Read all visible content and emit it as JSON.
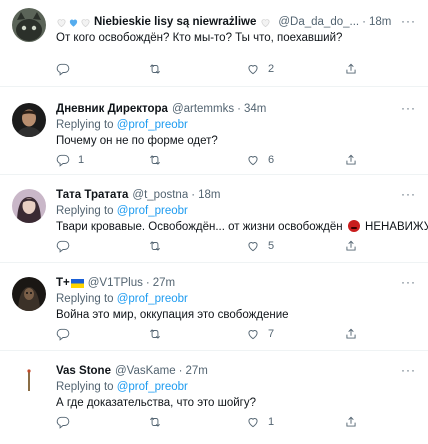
{
  "tweets": [
    {
      "name": "Niebieskie lisy są niewrażliwe",
      "handle": "@Da_da_do_...",
      "time": "18m",
      "replying_prefix": "",
      "replying_link": "",
      "text": "От кого освобождён? Кто мы-то? Ты что, поехавший?",
      "reply_count": "",
      "retweet_count": "",
      "like_count": "2",
      "avatar_icon": "dark-cat-avatar"
    },
    {
      "name": "Дневник Директора",
      "handle": "@artemmks",
      "time": "34m",
      "replying_prefix": "Replying to ",
      "replying_link": "@prof_preobr",
      "text": "Почему он не по форме одет?",
      "reply_count": "1",
      "retweet_count": "",
      "like_count": "6",
      "avatar_icon": "man-portrait-avatar"
    },
    {
      "name": "Тата Тратата",
      "handle": "@t_postna",
      "time": "18m",
      "replying_prefix": "Replying to ",
      "replying_link": "@prof_preobr",
      "text_before": "Твари кровавые. Освобождён... от жизни освобождён",
      "text_after": "НЕНАВИЖУ!",
      "reply_count": "",
      "retweet_count": "",
      "like_count": "5",
      "avatar_icon": "woman-portrait-avatar"
    },
    {
      "name": "T+",
      "handle": "@V1TPlus",
      "time": "27m",
      "replying_prefix": "Replying to ",
      "replying_link": "@prof_preobr",
      "text": "Война это мир, оккупация это свобождение",
      "reply_count": "",
      "retweet_count": "",
      "like_count": "7",
      "avatar_icon": "hooded-figure-avatar"
    },
    {
      "name": "Vas Stone",
      "handle": "@VasKame",
      "time": "27m",
      "replying_prefix": "Replying to ",
      "replying_link": "@prof_preobr",
      "text": "А где доказательства, что это шойгу?",
      "reply_count": "",
      "retweet_count": "",
      "like_count": "1",
      "avatar_icon": "egg-avatar"
    }
  ],
  "more_label": "···",
  "dot": "·",
  "colors": {
    "link": "#1d9bf0",
    "muted": "#536471",
    "text": "#0f1419",
    "divider": "#eff3f4"
  }
}
